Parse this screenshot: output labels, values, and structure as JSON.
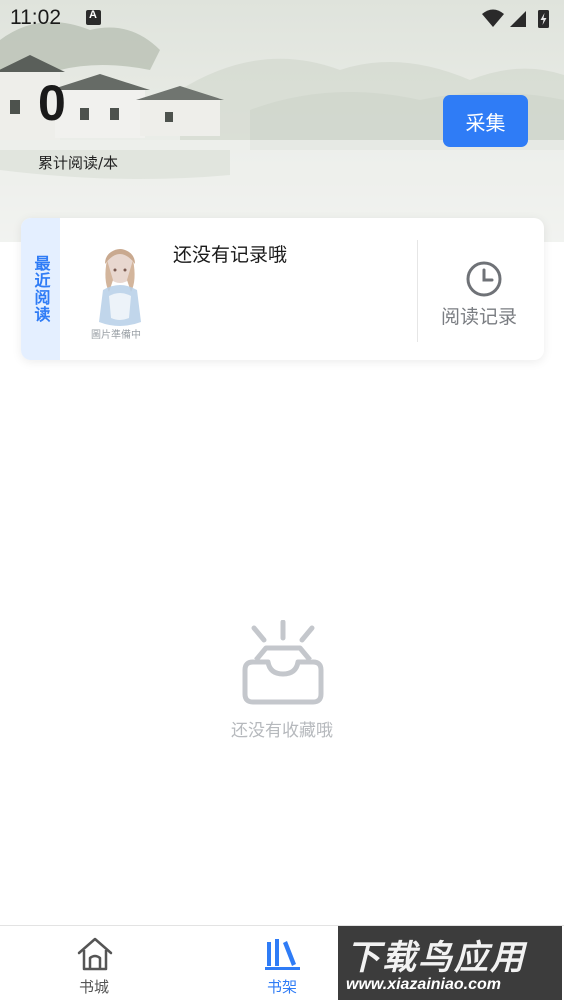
{
  "status_bar": {
    "time": "11:02",
    "notification_icon": "a-box-icon",
    "icons": [
      "wifi-icon",
      "cell-signal-icon",
      "battery-charging-icon"
    ]
  },
  "stats": {
    "count": "0",
    "label": "累计阅读/本"
  },
  "collect_button": {
    "label": "采集",
    "color": "#2f7cf6"
  },
  "recent": {
    "tag": "最近阅读",
    "cover_caption": "圖片準備中",
    "empty_message": "还没有记录哦",
    "history_label": "阅读记录"
  },
  "favorites": {
    "empty_message": "还没有收藏哦"
  },
  "bottom_nav": {
    "items": [
      {
        "label": "书城",
        "icon": "home-icon",
        "active": false
      },
      {
        "label": "书架",
        "icon": "bookshelf-icon",
        "active": true
      }
    ]
  },
  "watermark": {
    "title": "下载鸟应用",
    "url": "www.xiazainiao.com"
  },
  "colors": {
    "accent": "#2f7cf6",
    "muted": "#b6b9bd",
    "tag_background": "#e4efff"
  }
}
